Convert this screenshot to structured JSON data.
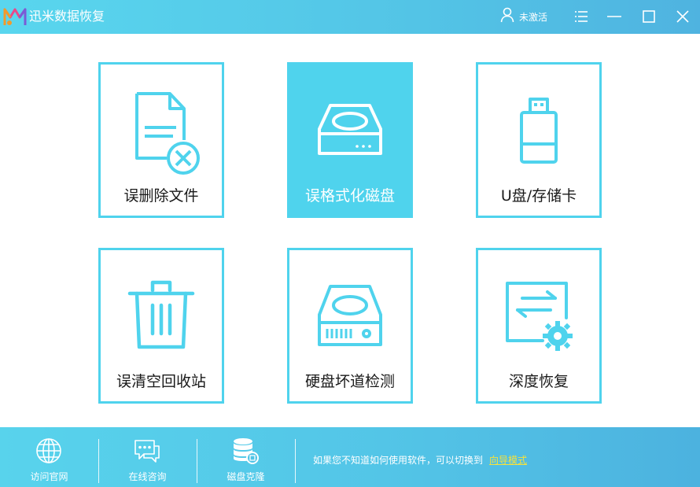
{
  "app": {
    "title": "迅米数据恢复"
  },
  "header": {
    "user_label": "未激活"
  },
  "cards": [
    {
      "label": "误删除文件",
      "icon": "deleted-file-icon"
    },
    {
      "label": "误格式化磁盘",
      "icon": "format-disk-icon",
      "active": true
    },
    {
      "label": "U盘/存储卡",
      "icon": "usb-drive-icon"
    },
    {
      "label": "误清空回收站",
      "icon": "recycle-bin-icon"
    },
    {
      "label": "硬盘坏道检测",
      "icon": "hdd-check-icon"
    },
    {
      "label": "深度恢复",
      "icon": "deep-recovery-icon"
    }
  ],
  "footer": {
    "items": [
      {
        "label": "访问官网",
        "icon": "globe-icon"
      },
      {
        "label": "在线咨询",
        "icon": "chat-icon"
      },
      {
        "label": "磁盘克隆",
        "icon": "database-clone-icon"
      }
    ],
    "hint_text": "如果您不知道如何使用软件，可以切换到",
    "hint_link": "向导模式"
  },
  "colors": {
    "accent": "#4fd3ed",
    "link": "#f7e23a",
    "active_card": "#4fd3ed"
  }
}
